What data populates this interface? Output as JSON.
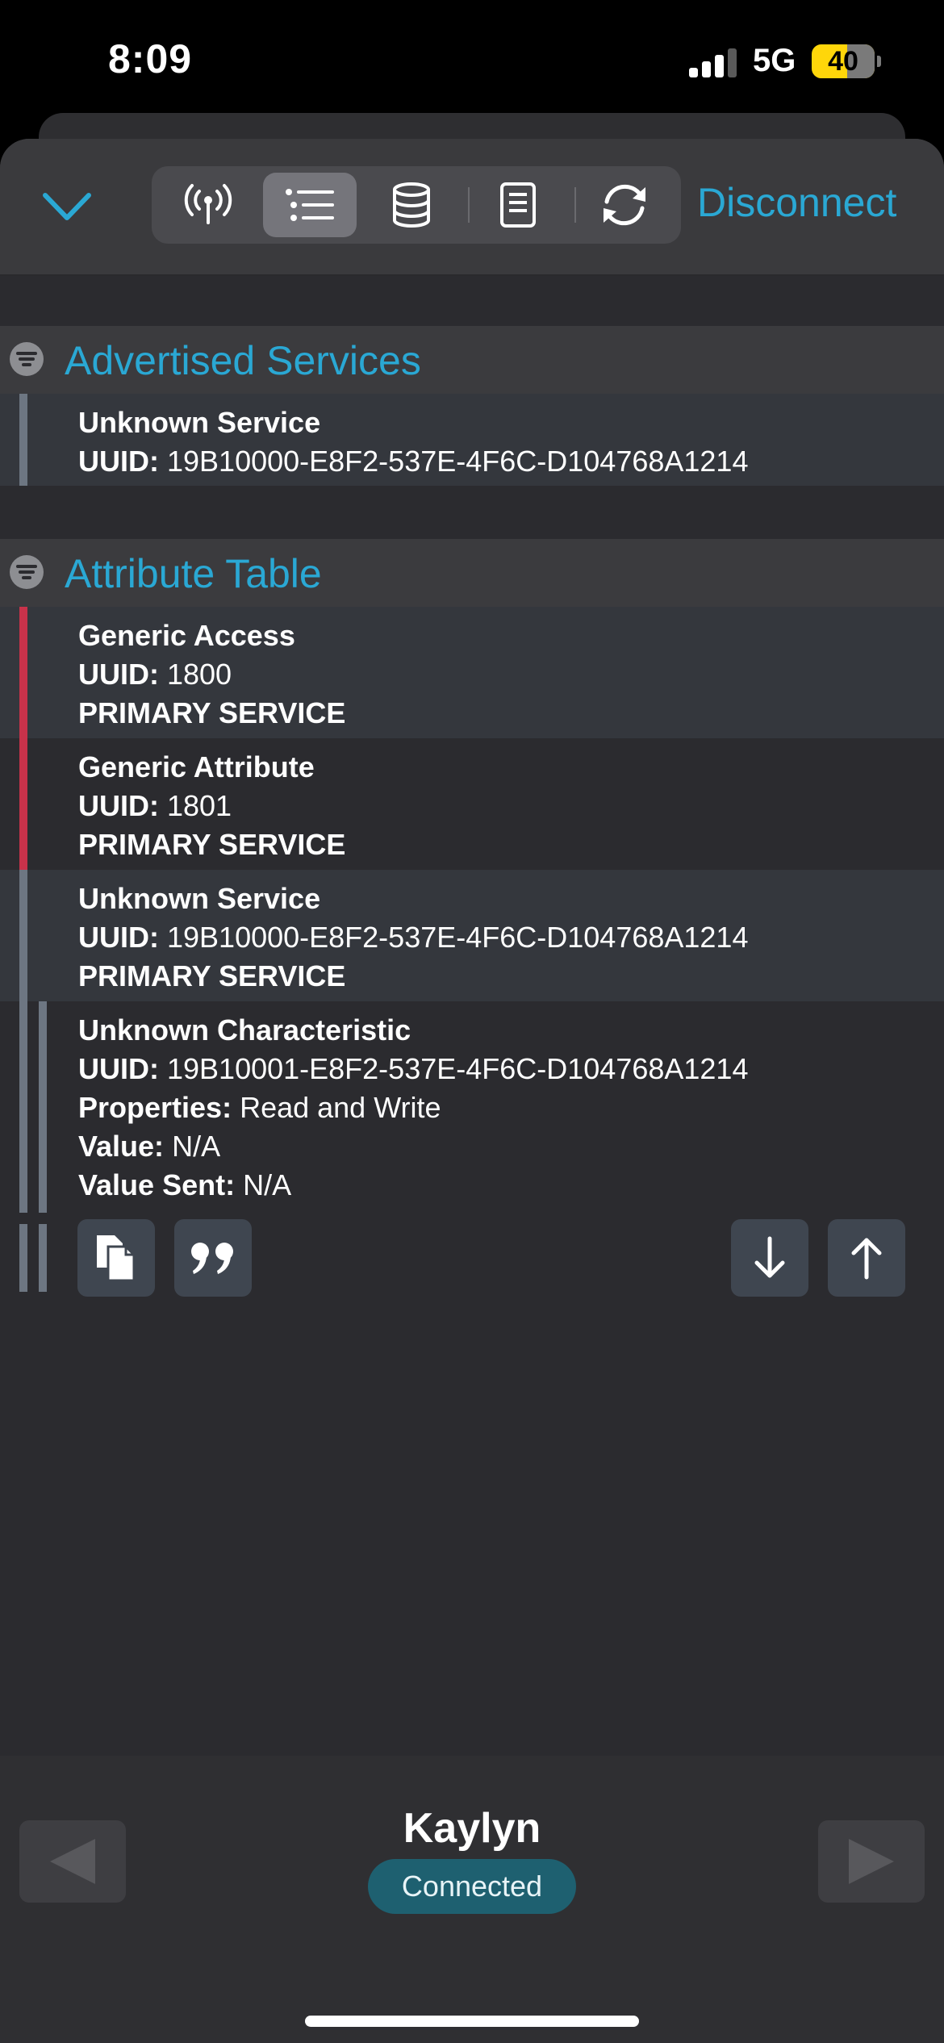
{
  "status_bar": {
    "time": "8:09",
    "network": "5G",
    "battery": "40"
  },
  "toolbar": {
    "disconnect_label": "Disconnect",
    "tabs": [
      {
        "icon": "antenna-icon",
        "active": false
      },
      {
        "icon": "list-icon",
        "active": true
      },
      {
        "icon": "database-icon",
        "active": false
      },
      {
        "icon": "document-icon",
        "active": false
      },
      {
        "icon": "refresh-icon",
        "active": false
      }
    ]
  },
  "sections": {
    "advertised": {
      "title": "Advertised Services",
      "items": [
        {
          "name": "Unknown Service",
          "uuid_label": "UUID:",
          "uuid": " 19B10000-E8F2-537E-4F6C-D104768A1214"
        }
      ]
    },
    "attribute_table": {
      "title": "Attribute Table",
      "items": [
        {
          "name": "Generic Access",
          "uuid_label": "UUID:",
          "uuid": " 1800",
          "type": "PRIMARY SERVICE"
        },
        {
          "name": "Generic Attribute",
          "uuid_label": "UUID:",
          "uuid": " 1801",
          "type": "PRIMARY SERVICE"
        },
        {
          "name": "Unknown Service",
          "uuid_label": "UUID:",
          "uuid": " 19B10000-E8F2-537E-4F6C-D104768A1214",
          "type": "PRIMARY SERVICE"
        }
      ],
      "characteristic": {
        "name": "Unknown Characteristic",
        "uuid_label": "UUID:",
        "uuid": " 19B10001-E8F2-537E-4F6C-D104768A1214",
        "properties_label": "Properties:",
        "properties": " Read and Write",
        "value_label": "Value:",
        "value": " N/A",
        "value_sent_label": "Value Sent:",
        "value_sent": " N/A"
      }
    }
  },
  "footer": {
    "device_name": "Kaylyn",
    "status": "Connected"
  },
  "colors": {
    "accent": "#2aa8d4",
    "service_bar_red": "#c8324a",
    "service_bar_gray": "#6d7682",
    "connected_pill": "#1e6070"
  }
}
